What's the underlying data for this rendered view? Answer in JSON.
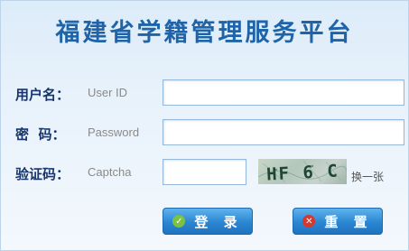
{
  "title": "福建省学籍管理服务平台",
  "form": {
    "username": {
      "label": "用户名：",
      "hint": "User ID",
      "value": ""
    },
    "password": {
      "label": "密  码：",
      "hint": "Password",
      "value": ""
    },
    "captcha": {
      "label": "验证码：",
      "hint": "Captcha",
      "value": "",
      "image_text": "HF 6 C",
      "refresh_label": "换一张"
    }
  },
  "buttons": {
    "login": {
      "label": "登 录",
      "icon": "check-icon",
      "icon_color": "#7cc242"
    },
    "reset": {
      "label": "重 置",
      "icon": "close-icon",
      "icon_color": "#d9362c"
    }
  },
  "colors": {
    "title": "#1f63a8",
    "label": "#17356b",
    "button": "#2b86d2"
  }
}
